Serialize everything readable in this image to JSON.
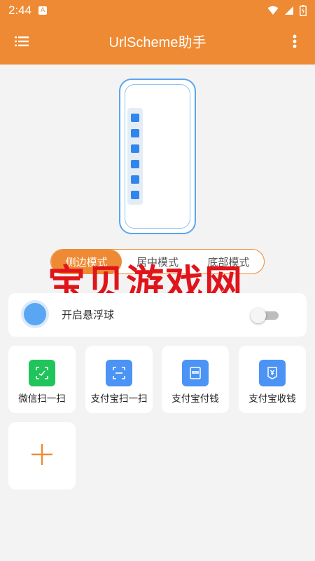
{
  "status_bar": {
    "time": "2:44",
    "notification_badge": "A",
    "icons": [
      "wifi-icon",
      "signal-icon",
      "battery-icon"
    ]
  },
  "app_bar": {
    "title": "UrlScheme助手",
    "menu_icon": "menu-icon",
    "more_icon": "more-vert-icon"
  },
  "mode_selector": {
    "options": [
      "侧边模式",
      "居中模式",
      "底部模式"
    ],
    "selected": "侧边模式"
  },
  "watermark": "宝贝游戏网",
  "float_ball": {
    "label": "开启悬浮球",
    "enabled": false
  },
  "actions": [
    {
      "label": "微信扫一扫",
      "icon": "wechat-scan-icon",
      "color": "#1fc45a"
    },
    {
      "label": "支付宝扫一扫",
      "icon": "alipay-scan-icon",
      "color": "#4b93f5"
    },
    {
      "label": "支付宝付钱",
      "icon": "alipay-pay-icon",
      "color": "#4b93f5"
    },
    {
      "label": "支付宝收钱",
      "icon": "alipay-receive-icon",
      "color": "#4b93f5"
    }
  ],
  "add_button_icon": "plus-icon",
  "colors": {
    "primary": "#ee8a33",
    "accent_blue": "#4b93f5",
    "wechat_green": "#1fc45a",
    "watermark_red": "#e0141a"
  }
}
